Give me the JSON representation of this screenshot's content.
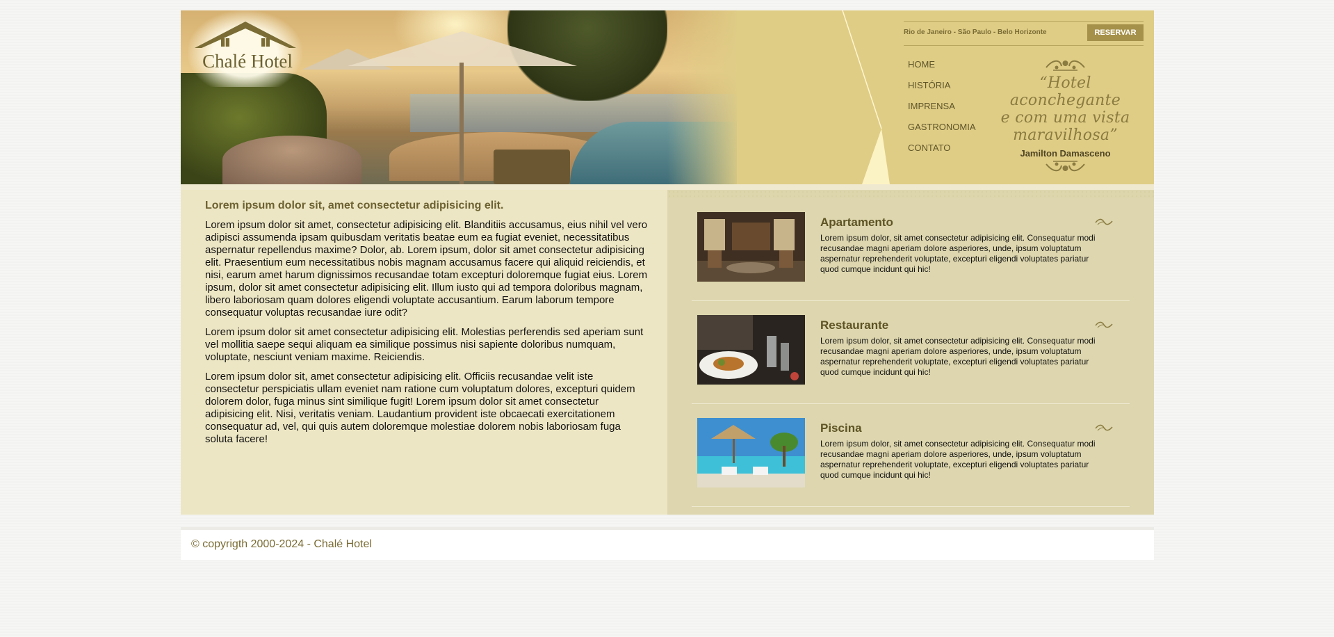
{
  "brand": {
    "name": "Chalé Hotel"
  },
  "header": {
    "cities": "Rio de Janeiro - São Paulo - Belo Horizonte",
    "reserve_label": "RESERVAR",
    "nav": [
      "HOME",
      "HISTÓRIA",
      "IMPRENSA",
      "GASTRONOMIA",
      "CONTATO"
    ],
    "quote_lines": [
      "“Hotel aconchegante",
      "e com uma vista",
      "maravilhosa”"
    ],
    "quote_author": "Jamilton Damasceno"
  },
  "main": {
    "title": "Lorem ipsum dolor sit, amet consectetur adipisicing elit.",
    "paragraphs": [
      "Lorem ipsum dolor sit amet, consectetur adipisicing elit. Blanditiis accusamus, eius nihil vel vero adipisci assumenda ipsam quibusdam veritatis beatae eum ea fugiat eveniet, necessitatibus aspernatur repellendus maxime? Dolor, ab. Lorem ipsum, dolor sit amet consectetur adipisicing elit. Praesentium eum necessitatibus nobis magnam accusamus facere qui aliquid reiciendis, et nisi, earum amet harum dignissimos recusandae totam excepturi doloremque fugiat eius. Lorem ipsum, dolor sit amet consectetur adipisicing elit. Illum iusto qui ad tempora doloribus magnam, libero laboriosam quam dolores eligendi voluptate accusantium. Earum laborum tempore consequatur voluptas recusandae iure odit?",
      "Lorem ipsum dolor sit amet consectetur adipisicing elit. Molestias perferendis sed aperiam sunt vel mollitia saepe sequi aliquam ea similique possimus nisi sapiente doloribus numquam, voluptate, nesciunt veniam maxime. Reiciendis.",
      "Lorem ipsum dolor sit, amet consectetur adipisicing elit. Officiis recusandae velit iste consectetur perspiciatis ullam eveniet nam ratione cum voluptatum dolores, excepturi quidem dolorem dolor, fuga minus sint similique fugit! Lorem ipsum dolor sit amet consectetur adipisicing elit. Nisi, veritatis veniam. Laudantium provident iste obcaecati exercitationem consequatur ad, vel, qui quis autem doloremque molestiae dolorem nobis laboriosam fuga soluta facere!"
    ]
  },
  "services": [
    {
      "title": "Apartamento",
      "text": "Lorem ipsum dolor, sit amet consectetur adipisicing elit. Consequatur modi recusandae magni aperiam dolore asperiores, unde, ipsum voluptatum aspernatur reprehenderit voluptate, excepturi eligendi voluptates pariatur quod cumque incidunt qui hic!"
    },
    {
      "title": "Restaurante",
      "text": "Lorem ipsum dolor, sit amet consectetur adipisicing elit. Consequatur modi recusandae magni aperiam dolore asperiores, unde, ipsum voluptatum aspernatur reprehenderit voluptate, excepturi eligendi voluptates pariatur quod cumque incidunt qui hic!"
    },
    {
      "title": "Piscina",
      "text": "Lorem ipsum dolor, sit amet consectetur adipisicing elit. Consequatur modi recusandae magni aperiam dolore asperiores, unde, ipsum voluptatum aspernatur reprehenderit voluptate, excepturi eligendi voluptates pariatur quod cumque incidunt qui hic!"
    }
  ],
  "footer": {
    "copyright": "© copyrigth 2000-2024 - Chalé Hotel"
  },
  "colors": {
    "gold": "#dfcd86",
    "button": "#a6914a",
    "text_brand": "#6c6131"
  }
}
